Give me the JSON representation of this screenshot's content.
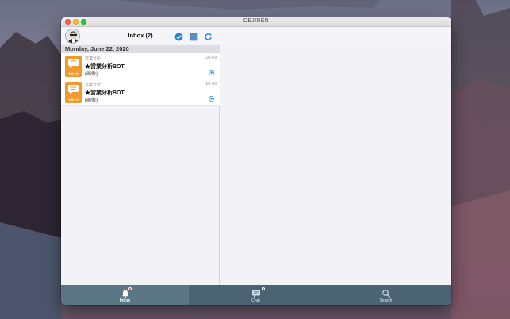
{
  "window": {
    "title": "DEJIREN"
  },
  "inbox": {
    "title": "Inbox (2)",
    "date_header": "Monday, June 22, 2020",
    "messages": [
      {
        "sender": "営業分析",
        "title": "★営業分析BOT",
        "body": "(画像)",
        "time": "16:43",
        "icon": "chat-bubble-icon",
        "rating": "★★★★"
      },
      {
        "sender": "営業分析",
        "title": "★営業分析BOT",
        "body": "(画像)",
        "time": "16:40",
        "icon": "chat-bubble-icon",
        "rating": "★★★★"
      }
    ]
  },
  "tabs": [
    {
      "label": "Inbox",
      "icon": "bell-icon",
      "active": true,
      "badge": true
    },
    {
      "label": "Chat",
      "icon": "chat-icon",
      "active": false,
      "badge": true
    },
    {
      "label": "Search",
      "icon": "search-icon",
      "active": false,
      "badge": false
    }
  ],
  "colors": {
    "tabbar": "#4b6473",
    "tab_active": "#5b7685",
    "message_icon": "#f29a2e",
    "accent_blue": "#1e88e5",
    "badge_red": "#e53935"
  }
}
